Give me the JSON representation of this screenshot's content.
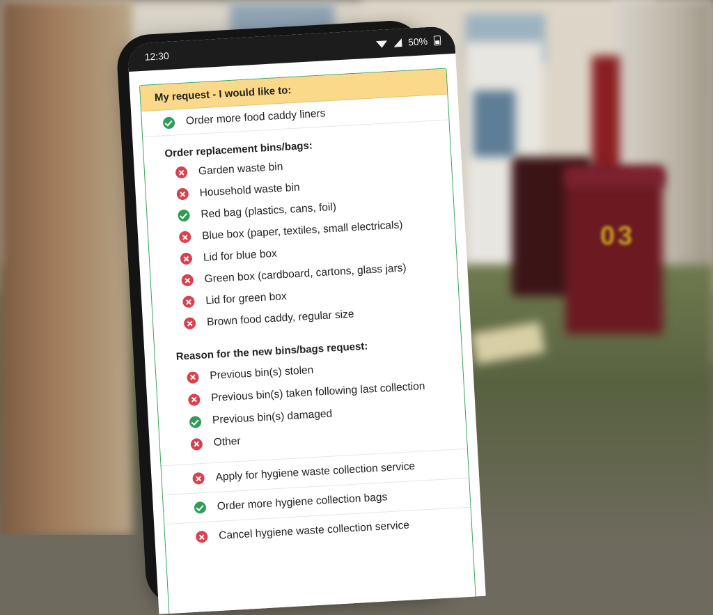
{
  "status_bar": {
    "time": "12:30",
    "battery": "50%"
  },
  "form": {
    "header": "My request - I would like to:",
    "top_option": {
      "label": "Order more food caddy liners",
      "state": "check"
    },
    "replacement_heading": "Order replacement bins/bags:",
    "replacement_items": [
      {
        "label": "Garden waste bin",
        "state": "cross"
      },
      {
        "label": "Household waste bin",
        "state": "cross"
      },
      {
        "label": "Red bag (plastics, cans, foil)",
        "state": "check"
      },
      {
        "label": "Blue box (paper, textiles, small electricals)",
        "state": "cross"
      },
      {
        "label": "Lid for blue box",
        "state": "cross"
      },
      {
        "label": "Green box (cardboard, cartons, glass jars)",
        "state": "cross"
      },
      {
        "label": "Lid for green box",
        "state": "cross"
      },
      {
        "label": "Brown food caddy, regular size",
        "state": "cross"
      }
    ],
    "reason_heading": "Reason for the new bins/bags request:",
    "reason_items": [
      {
        "label": "Previous bin(s) stolen",
        "state": "cross"
      },
      {
        "label": "Previous bin(s) taken following last collection",
        "state": "cross"
      },
      {
        "label": "Previous bin(s) damaged",
        "state": "check"
      },
      {
        "label": "Other",
        "state": "cross"
      }
    ],
    "bottom_options": [
      {
        "label": "Apply for hygiene waste collection service",
        "state": "cross"
      },
      {
        "label": "Order more hygiene collection bags",
        "state": "check"
      },
      {
        "label": "Cancel hygiene waste collection service",
        "state": "cross"
      }
    ]
  },
  "background": {
    "bin_number": "03"
  },
  "colors": {
    "check": "#2f9e55",
    "cross": "#d9414f",
    "header_bg": "#fbd98a",
    "border": "#3aa35b"
  }
}
